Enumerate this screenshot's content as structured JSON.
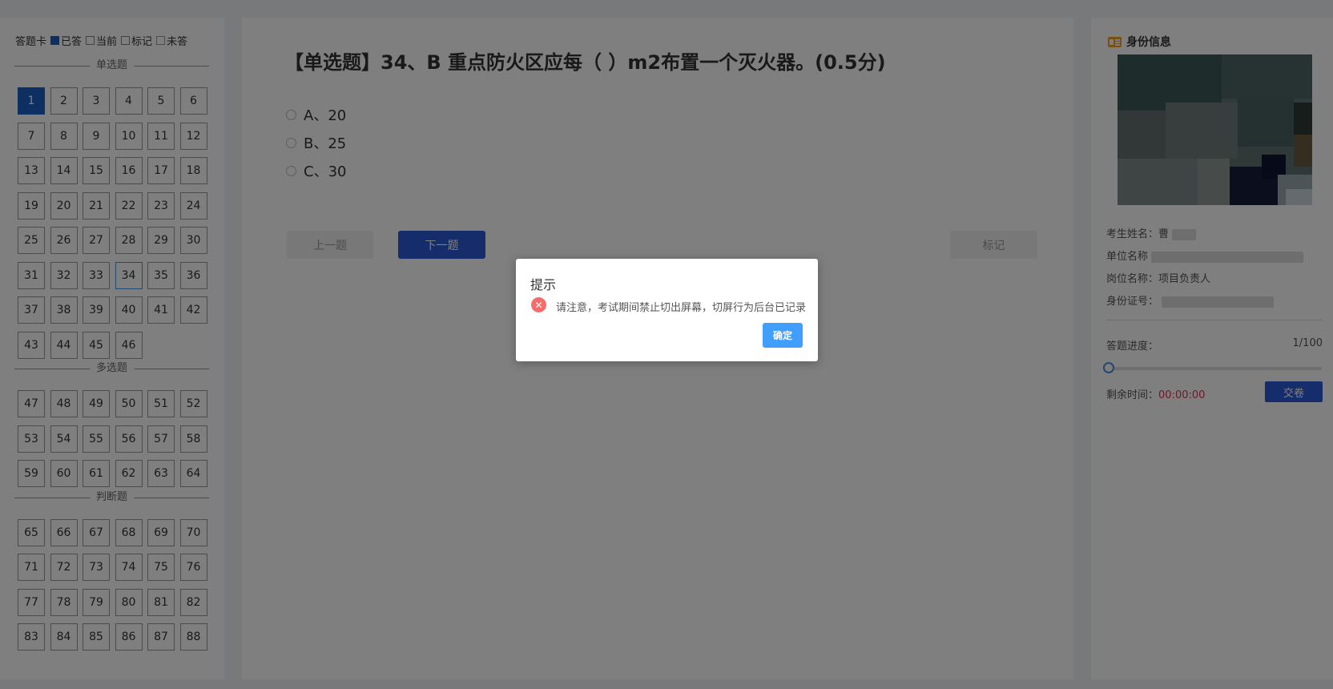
{
  "legend": {
    "title": "答题卡",
    "answered": "已答",
    "current": "当前",
    "marked": "标记",
    "unanswered": "未答"
  },
  "sections": [
    {
      "name": "单选题",
      "questions": [
        "1",
        "2",
        "3",
        "4",
        "5",
        "6",
        "7",
        "8",
        "9",
        "10",
        "11",
        "12",
        "13",
        "14",
        "15",
        "16",
        "17",
        "18",
        "19",
        "20",
        "21",
        "22",
        "23",
        "24",
        "25",
        "26",
        "27",
        "28",
        "29",
        "30",
        "31",
        "32",
        "33",
        "34",
        "35",
        "36",
        "37",
        "38",
        "39",
        "40",
        "41",
        "42",
        "43",
        "44",
        "45",
        "46"
      ]
    },
    {
      "name": "多选题",
      "questions": [
        "47",
        "48",
        "49",
        "50",
        "51",
        "52",
        "53",
        "54",
        "55",
        "56",
        "57",
        "58",
        "59",
        "60",
        "61",
        "62",
        "63",
        "64"
      ]
    },
    {
      "name": "判断题",
      "questions": [
        "65",
        "66",
        "67",
        "68",
        "69",
        "70",
        "71",
        "72",
        "73",
        "74",
        "75",
        "76",
        "77",
        "78",
        "79",
        "80",
        "81",
        "82",
        "83",
        "84",
        "85",
        "86",
        "87",
        "88"
      ]
    }
  ],
  "answered_questions": [
    "1"
  ],
  "current_question": "34",
  "question": {
    "title": "【单选题】34、B 重点防火区应每（ ）m2布置一个灭火器。(0.5分)",
    "options": [
      "A、20",
      "B、25",
      "C、30"
    ]
  },
  "nav": {
    "prev": "上一题",
    "next": "下一题",
    "mark": "标记"
  },
  "identity": {
    "title": "身份信息",
    "name_label": "考生姓名：",
    "name_value": "曹",
    "unit_label": "单位名称",
    "position_label": "岗位名称：",
    "position_value": "项目负责人",
    "id_label": "身份证号："
  },
  "progress": {
    "label": "答题进度：",
    "value": "1/100",
    "fraction": 0.01
  },
  "timer": {
    "label": "剩余时间：",
    "value": "00:00:00"
  },
  "submit": "交卷",
  "dialog": {
    "title": "提示",
    "message": "请注意，考试期间禁止切出屏幕，切屏行为后台已记录",
    "ok": "确定"
  },
  "colors": {
    "accent": "#2a5bd7",
    "answered": "#1d5fc2",
    "timer": "#e0304a",
    "dialog_ok": "#409eff",
    "error": "#f56c6c"
  }
}
